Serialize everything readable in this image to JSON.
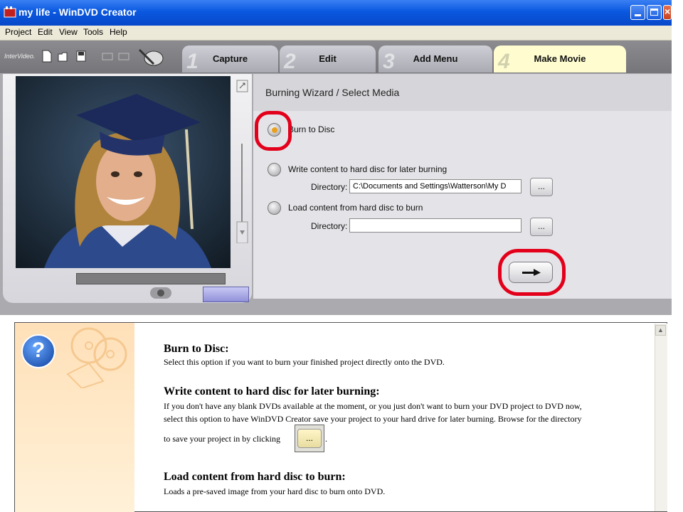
{
  "window": {
    "title": "my life - WinDVD Creator"
  },
  "menu": [
    "Project",
    "Edit",
    "View",
    "Tools",
    "Help"
  ],
  "toolbar": {
    "logo": "InterVideo."
  },
  "tabs": [
    {
      "num": "1",
      "label": "Capture"
    },
    {
      "num": "2",
      "label": "Edit"
    },
    {
      "num": "3",
      "label": "Add Menu"
    },
    {
      "num": "4",
      "label": "Make Movie"
    }
  ],
  "wizard": {
    "title": "Burning Wizard / Select Media",
    "options": [
      {
        "label": "Burn to Disc",
        "selected": true
      },
      {
        "label": "Write content to hard disc for later burning",
        "selected": false
      },
      {
        "label": "Load content from hard disc to burn",
        "selected": false
      }
    ],
    "directory_label": "Directory:",
    "directory_value_1": "C:\\Documents and Settings\\Watterson\\My D",
    "directory_value_2": "",
    "browse_label": "...",
    "next_icon": "arrow-right-icon"
  },
  "help": {
    "sections": [
      {
        "heading": "Burn to Disc:",
        "lines": [
          "Select this option if you want to burn your finished project directly onto the DVD."
        ]
      },
      {
        "heading": "Write content to hard disc for later burning:",
        "lines": [
          "If you don't have any blank DVDs available at the moment, or you just don't want to burn your DVD project to DVD now,",
          "select this option to have WinDVD Creator save your project to your hard drive for later burning. Browse for the directory",
          "to save your project in by clicking",
          "."
        ]
      },
      {
        "heading": "Load content from hard disc to burn:",
        "lines": [
          "Loads a pre-saved image from your hard disc to burn onto DVD."
        ]
      }
    ],
    "inline_button": "..."
  },
  "colors": {
    "highlight": "#e3001b",
    "titlebar": "#0a58e0",
    "active_tab": "#fffdd0"
  }
}
